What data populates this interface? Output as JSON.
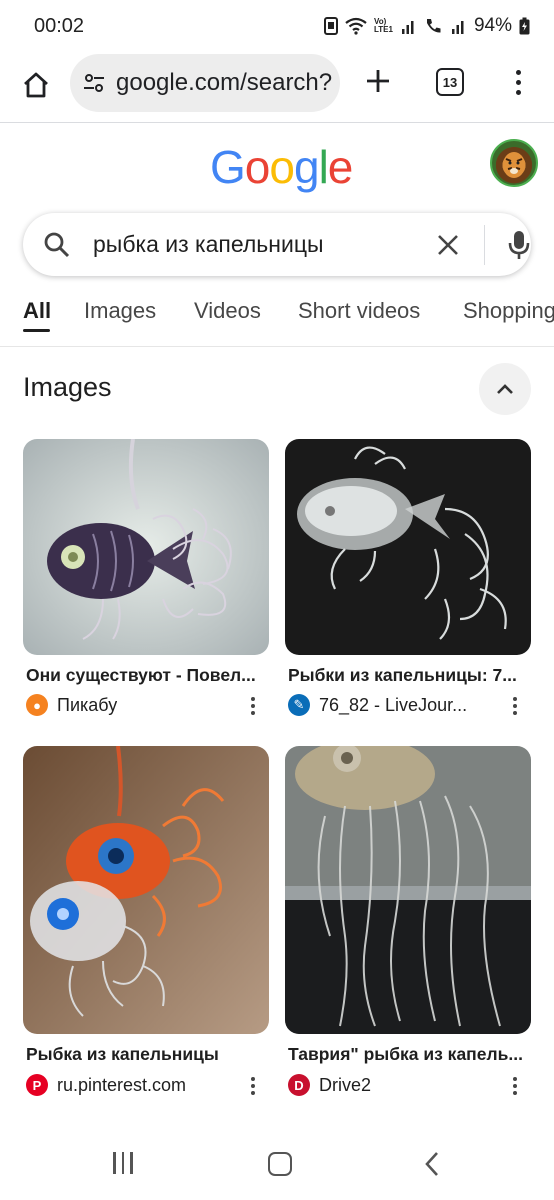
{
  "status_bar": {
    "time": "00:02",
    "battery": "94%",
    "network_label": "Vo) LTE1"
  },
  "browser": {
    "url": "google.com/search?",
    "tab_count": "13"
  },
  "google": {
    "logo_letters": [
      {
        "ch": "G",
        "color": "#4285F4"
      },
      {
        "ch": "o",
        "color": "#EA4335"
      },
      {
        "ch": "o",
        "color": "#FBBC05"
      },
      {
        "ch": "g",
        "color": "#4285F4"
      },
      {
        "ch": "l",
        "color": "#34A853"
      },
      {
        "ch": "e",
        "color": "#EA4335"
      }
    ]
  },
  "search": {
    "query": "рыбка из капельницы"
  },
  "tabs": [
    "All",
    "Images",
    "Videos",
    "Short videos",
    "Shopping"
  ],
  "images_section": {
    "title": "Images",
    "results": [
      {
        "title": "Они существуют - Повел...",
        "source": "Пикабу",
        "favicon": "pikabu-icon",
        "favicon_color": "#f58220"
      },
      {
        "title": "Рыбки из капельницы: 7...",
        "source": "76_82 - LiveJour...",
        "favicon": "livejournal-icon",
        "favicon_color": "#0a6db8"
      },
      {
        "title": "Рыбка из капельницы",
        "source": "ru.pinterest.com",
        "favicon": "pinterest-icon",
        "favicon_color": "#e60023"
      },
      {
        "title": "Таврия\" рыбка из капель...",
        "source": "Drive2",
        "favicon": "drive2-icon",
        "favicon_color": "#c8102e"
      }
    ]
  }
}
